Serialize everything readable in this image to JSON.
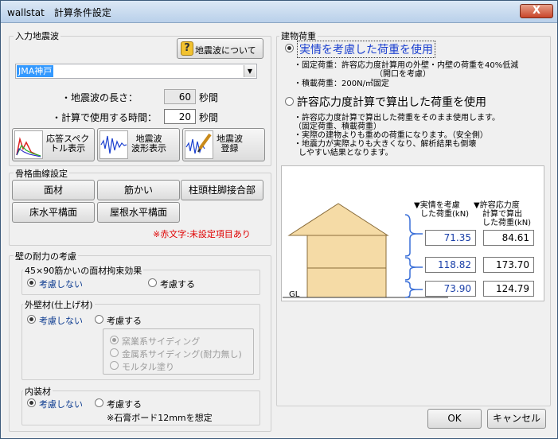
{
  "window": {
    "title": "wallstat　計算条件設定",
    "close_label": "X"
  },
  "quake": {
    "group_label": "入力地震波",
    "about_button": "地震波について",
    "selected_wave": "JMA神戸",
    "length_label": "・地震波の長さ：",
    "length_value": "60",
    "length_unit": "秒間",
    "calc_time_label": "・計算で使用する時間：",
    "calc_time_value": "20",
    "calc_time_unit": "秒間",
    "spectrum_button": "応答スペク\nトル表示",
    "waveform_button": "地震波\n波形表示",
    "register_button": "地震波\n登録"
  },
  "skeleton": {
    "group_label": "骨格曲線設定",
    "buttons": [
      "面材",
      "筋かい",
      "柱頭柱脚接合部",
      "床水平構面",
      "屋根水平構面"
    ],
    "note": "※赤文字:未設定項目あり"
  },
  "wall": {
    "group_label": "壁の耐力の考慮",
    "sub1": {
      "label": "45×90筋かいの面材拘束効果",
      "opt_no": "考慮しない",
      "opt_yes": "考慮する"
    },
    "sub2": {
      "label": "外壁材(仕上げ材)",
      "opt_no": "考慮しない",
      "opt_yes": "考慮する",
      "materials": [
        "窯業系サイディング",
        "金属系サイディング(耐力無し)",
        "モルタル塗り"
      ]
    },
    "sub3": {
      "label": "内装材",
      "opt_no": "考慮しない",
      "opt_yes": "考慮する",
      "note": "※石膏ボード12mmを想定"
    }
  },
  "load": {
    "group_label": "建物荷重",
    "option1": "実情を考慮した荷重を使用",
    "option1_notes": [
      "・固定荷重：許容応力度計算用の外壁・内壁の荷重を40%低減",
      "（開口を考慮）",
      "・積載荷重：200N/㎡固定"
    ],
    "option2": "許容応力度計算で算出した荷重を使用",
    "option2_notes": [
      "・許容応力度計算で算出した荷重をそのまま使用します。",
      "（固定荷重、積載荷重）",
      "・実際の建物よりも重めの荷重になります。（安全側）",
      "・地震力が実際よりも大きくなり、解析結果も倒壊",
      "しやすい結果となります。"
    ],
    "col1_header": [
      "▼実情を考慮",
      "した荷重(kN)"
    ],
    "col2_header": [
      "▼許容応力度",
      "計算で算出",
      "した荷重(kN)"
    ],
    "rows": [
      {
        "actual": "71.35",
        "calc": "84.61"
      },
      {
        "actual": "118.82",
        "calc": "173.70"
      },
      {
        "actual": "73.90",
        "calc": "124.79"
      }
    ],
    "gl_label": "GL",
    "colors": {
      "house": "#f5dba6",
      "house_line": "#8a6d3b",
      "bracket": "#3a6fd8",
      "actual_text": "#1a3fa8"
    }
  },
  "footer": {
    "ok": "OK",
    "cancel": "キャンセル"
  }
}
